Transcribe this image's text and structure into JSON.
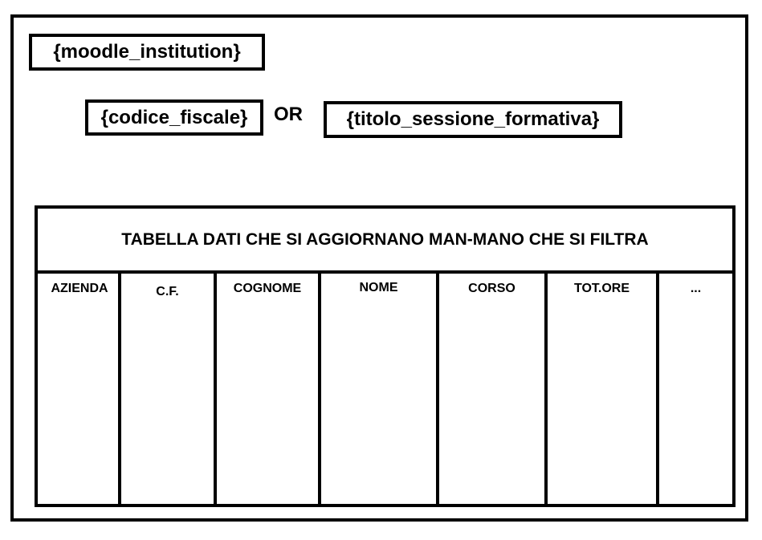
{
  "filters": {
    "institution": "{moodle_institution}",
    "codice_fiscale": "{codice_fiscale}",
    "connector": "OR",
    "titolo_sessione": "{titolo_sessione_formativa}"
  },
  "table": {
    "title": "TABELLA DATI CHE SI AGGIORNANO MAN-MANO CHE SI FILTRA",
    "columns": [
      "AZIENDA",
      "C.F.",
      "COGNOME",
      "NOME",
      "CORSO",
      "TOT.ORE",
      "..."
    ]
  }
}
